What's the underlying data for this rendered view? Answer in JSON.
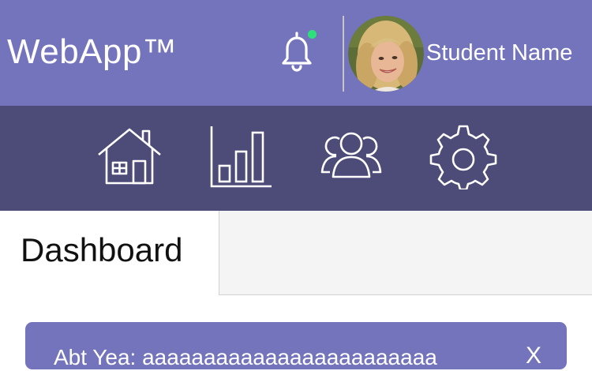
{
  "header": {
    "app_name": "WebApp™",
    "user_name": "Student Name",
    "notification_indicator_color": "#2ee07a",
    "background_color": "#7474bd"
  },
  "nav": {
    "background_color": "#4d4b78",
    "items": [
      {
        "icon": "home-icon"
      },
      {
        "icon": "bar-chart-icon"
      },
      {
        "icon": "users-icon"
      },
      {
        "icon": "gear-icon"
      }
    ]
  },
  "tabs": {
    "active_label": "Dashboard"
  },
  "card": {
    "title": "Abt Yea: aaaaaaaaaaaaaaaaaaaaaaaa",
    "close_glyph": "X"
  }
}
